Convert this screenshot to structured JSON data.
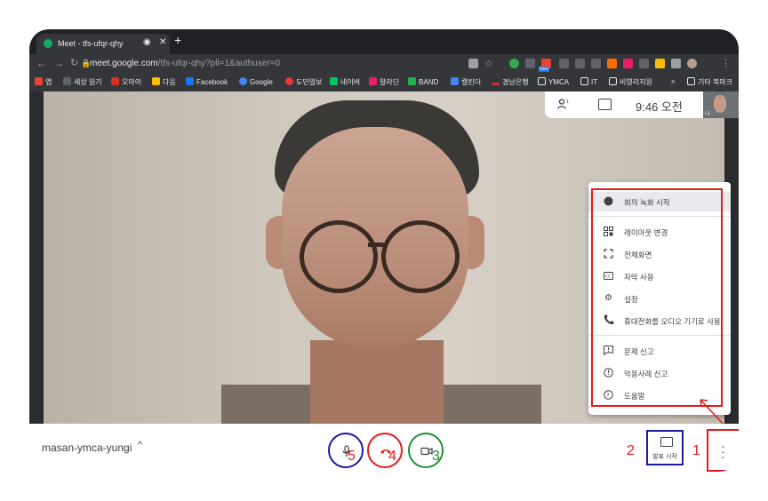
{
  "browser": {
    "tab_title": "Meet - tfs-ufqr-qhy",
    "new_tab": "+",
    "url_host": "meet.google.com",
    "url_path": "/tfs-ufqr-qhy?pli=1&authuser=0",
    "ext_badge": "New"
  },
  "bookmarks": [
    "앱",
    "세상 읽기",
    "오마이",
    "다음",
    "Facebook",
    "Google",
    "도민일보",
    "네이버",
    "알라딘",
    "BAND",
    "캘린더",
    "경남은행",
    "YMCA",
    "IT",
    "비영리지원",
    "»",
    "기타 북마크"
  ],
  "meet": {
    "time": "9:46 오전",
    "self_label": "나",
    "meeting_code": "masan-ymca-yungi",
    "present_label": "발표 시작"
  },
  "menu": {
    "items": [
      "회의 녹화 시작",
      "레이아웃 변경",
      "전체화면",
      "자막 사용",
      "설정",
      "휴대전화를 오디오 기기로 사용",
      "문제 신고",
      "악용사례 신고",
      "도움말"
    ]
  },
  "annotations": [
    "1",
    "2",
    "3",
    "4",
    "5"
  ],
  "colors": {
    "red": "#e11b1b",
    "blue": "#1a1aa6",
    "green": "#1e8e2e",
    "end_call": "#d93025"
  }
}
